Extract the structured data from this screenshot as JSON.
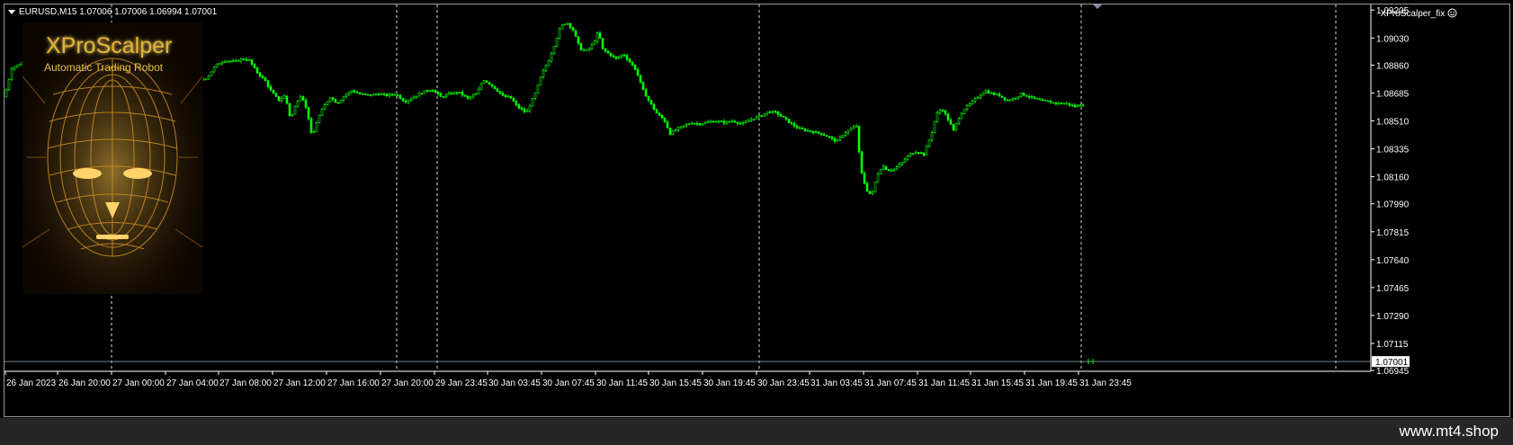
{
  "window": {
    "symbol_title": "EURUSD,M15  1.07006 1.07006 1.06994 1.07001",
    "ea_label": "XProScalper_fix"
  },
  "overlay": {
    "logo_title": "XProScalper",
    "logo_subtitle": "Automatic Trading Robot",
    "icon": "face-wireframe-logo"
  },
  "footer": {
    "site": "www.mt4.shop"
  },
  "colors": {
    "bull": "#00ff00",
    "bear": "#00ff00",
    "axis": "#ffffff",
    "grid": "#ffffff",
    "bid_line": "#778899",
    "price_box": "#ffffff"
  },
  "chart_data": {
    "type": "candlestick",
    "symbol": "EURUSD",
    "timeframe": "M15",
    "ylim": [
      1.0694,
      1.0924
    ],
    "price_ticks": [
      1.09205,
      1.0903,
      1.0886,
      1.08685,
      1.0851,
      1.08335,
      1.0816,
      1.0799,
      1.07815,
      1.0764,
      1.07465,
      1.0729,
      1.07115,
      1.06945
    ],
    "price_labels": [
      "1.09205",
      "1.09030",
      "1.08860",
      "1.08685",
      "1.08510",
      "1.08335",
      "1.08160",
      "1.07990",
      "1.07815",
      "1.07640",
      "1.07465",
      "1.07290",
      "1.07115",
      "1.06945"
    ],
    "current_price": "1.07001",
    "time_labels": [
      "26 Jan 2023",
      "26 Jan 20:00",
      "27 Jan 00:00",
      "27 Jan 04:00",
      "27 Jan 08:00",
      "27 Jan 12:00",
      "27 Jan 16:00",
      "27 Jan 20:00",
      "29 Jan 23:45",
      "30 Jan 03:45",
      "30 Jan 07:45",
      "30 Jan 11:45",
      "30 Jan 15:45",
      "30 Jan 19:45",
      "30 Jan 23:45",
      "31 Jan 03:45",
      "31 Jan 07:45",
      "31 Jan 11:45",
      "31 Jan 15:45",
      "31 Jan 19:45",
      "31 Jan 23:45"
    ],
    "close_path": [
      [
        0,
        1.0866
      ],
      [
        8,
        1.0884
      ],
      [
        22,
        1.0888
      ],
      [
        35,
        1.0891
      ],
      [
        50,
        1.0893
      ],
      [
        65,
        1.0892
      ],
      [
        80,
        1.089
      ],
      [
        95,
        1.0889
      ],
      [
        110,
        1.0891
      ],
      [
        125,
        1.0889
      ],
      [
        140,
        1.0886
      ],
      [
        155,
        1.0882
      ],
      [
        165,
        1.0875
      ],
      [
        175,
        1.0872
      ],
      [
        185,
        1.087
      ],
      [
        195,
        1.0869
      ],
      [
        205,
        1.0872
      ],
      [
        215,
        1.0876
      ],
      [
        225,
        1.0878
      ],
      [
        235,
        1.0886
      ],
      [
        245,
        1.0889
      ],
      [
        255,
        1.0888
      ],
      [
        265,
        1.089
      ],
      [
        272,
        1.0889
      ],
      [
        280,
        1.0882
      ],
      [
        290,
        1.0876
      ],
      [
        297,
        1.0869
      ],
      [
        305,
        1.0864
      ],
      [
        312,
        1.0867
      ],
      [
        318,
        1.0852
      ],
      [
        325,
        1.0863
      ],
      [
        330,
        1.0868
      ],
      [
        337,
        1.0856
      ],
      [
        342,
        1.084
      ],
      [
        348,
        1.0852
      ],
      [
        355,
        1.086
      ],
      [
        362,
        1.0866
      ],
      [
        370,
        1.0862
      ],
      [
        378,
        1.0867
      ],
      [
        386,
        1.087
      ],
      [
        395,
        1.0868
      ],
      [
        405,
        1.0867
      ],
      [
        415,
        1.0868
      ],
      [
        425,
        1.0867
      ],
      [
        435,
        1.0868
      ],
      [
        445,
        1.0863
      ],
      [
        455,
        1.0866
      ],
      [
        465,
        1.0869
      ],
      [
        475,
        1.0871
      ],
      [
        485,
        1.0866
      ],
      [
        495,
        1.0868
      ],
      [
        505,
        1.0869
      ],
      [
        515,
        1.0865
      ],
      [
        525,
        1.0868
      ],
      [
        532,
        1.0877
      ],
      [
        540,
        1.0874
      ],
      [
        548,
        1.087
      ],
      [
        555,
        1.0866
      ],
      [
        562,
        1.0866
      ],
      [
        570,
        1.086
      ],
      [
        580,
        1.0856
      ],
      [
        590,
        1.0868
      ],
      [
        597,
        1.088
      ],
      [
        605,
        1.0889
      ],
      [
        612,
        1.09
      ],
      [
        618,
        1.091
      ],
      [
        625,
        1.0913
      ],
      [
        632,
        1.0908
      ],
      [
        640,
        1.0896
      ],
      [
        648,
        1.0895
      ],
      [
        655,
        1.09
      ],
      [
        660,
        1.0907
      ],
      [
        665,
        1.0896
      ],
      [
        672,
        1.0893
      ],
      [
        680,
        1.089
      ],
      [
        688,
        1.0893
      ],
      [
        695,
        1.0888
      ],
      [
        702,
        1.0883
      ],
      [
        710,
        1.087
      ],
      [
        718,
        1.0862
      ],
      [
        726,
        1.0855
      ],
      [
        733,
        1.0852
      ],
      [
        740,
        1.0843
      ],
      [
        748,
        1.0846
      ],
      [
        756,
        1.0848
      ],
      [
        764,
        1.085
      ],
      [
        772,
        1.0849
      ],
      [
        780,
        1.085
      ],
      [
        790,
        1.0851
      ],
      [
        800,
        1.085
      ],
      [
        810,
        1.0851
      ],
      [
        820,
        1.0849
      ],
      [
        830,
        1.0852
      ],
      [
        840,
        1.0854
      ],
      [
        850,
        1.0857
      ],
      [
        858,
        1.0856
      ],
      [
        866,
        1.0853
      ],
      [
        875,
        1.0849
      ],
      [
        884,
        1.0846
      ],
      [
        892,
        1.0845
      ],
      [
        900,
        1.0844
      ],
      [
        908,
        1.0843
      ],
      [
        916,
        1.0841
      ],
      [
        925,
        1.0838
      ],
      [
        933,
        1.0843
      ],
      [
        941,
        1.0846
      ],
      [
        947,
        1.0848
      ],
      [
        952,
        1.082
      ],
      [
        958,
        1.0808
      ],
      [
        964,
        1.0804
      ],
      [
        970,
        1.0817
      ],
      [
        976,
        1.0823
      ],
      [
        982,
        1.082
      ],
      [
        990,
        1.0821
      ],
      [
        998,
        1.0825
      ],
      [
        1006,
        1.083
      ],
      [
        1014,
        1.0832
      ],
      [
        1022,
        1.083
      ],
      [
        1030,
        1.0842
      ],
      [
        1036,
        1.0855
      ],
      [
        1042,
        1.0859
      ],
      [
        1048,
        1.0853
      ],
      [
        1055,
        1.0845
      ],
      [
        1060,
        1.0852
      ],
      [
        1066,
        1.0858
      ],
      [
        1074,
        1.0862
      ],
      [
        1082,
        1.0866
      ],
      [
        1090,
        1.087
      ],
      [
        1098,
        1.0868
      ],
      [
        1106,
        1.0867
      ],
      [
        1114,
        1.0864
      ],
      [
        1122,
        1.0865
      ],
      [
        1130,
        1.0868
      ],
      [
        1140,
        1.0866
      ],
      [
        1150,
        1.0864
      ],
      [
        1160,
        1.0863
      ],
      [
        1170,
        1.0862
      ],
      [
        1180,
        1.0862
      ],
      [
        1190,
        1.086
      ],
      [
        1200,
        1.0862
      ]
    ],
    "last_bars_x": [
      1205,
      1210
    ],
    "last_bar_price": 1.07001
  }
}
